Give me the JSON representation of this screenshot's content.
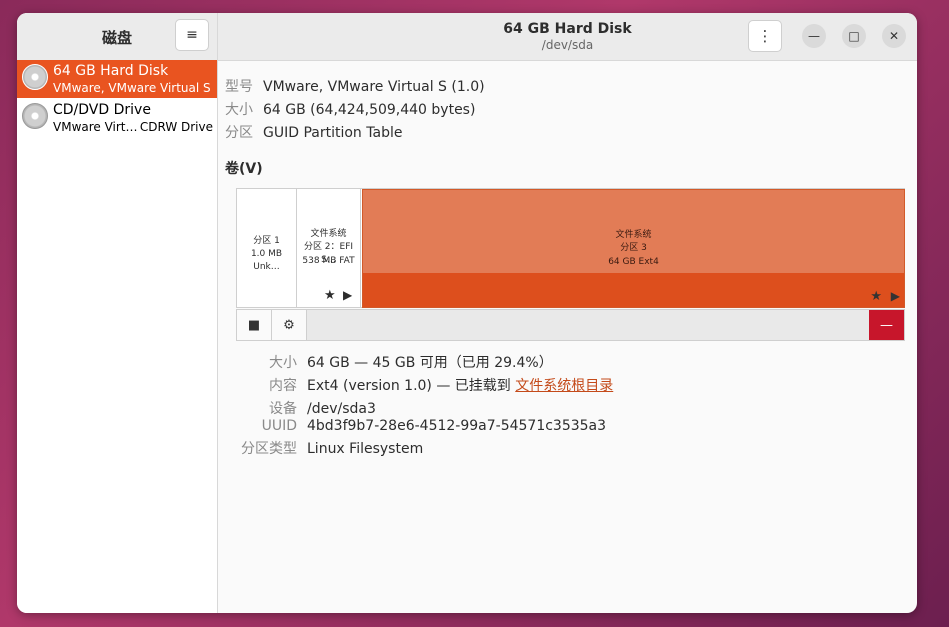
{
  "sidebar": {
    "title": "磁盘",
    "menu_icon": "≡",
    "drives": [
      {
        "name": "64 GB Hard Disk",
        "sub": "VMware, VMware Virtual S",
        "sub2": ""
      },
      {
        "name": "CD/DVD Drive",
        "sub": "VMware Virt…",
        "sub2": "CDRW Drive"
      }
    ]
  },
  "header": {
    "title": "64 GB Hard Disk",
    "subtitle": "/dev/sda",
    "more_icon": "⋮",
    "min_icon": "—",
    "max_icon": "□",
    "close_icon": "✕"
  },
  "info": {
    "model_label": "型号",
    "model_value": "VMware, VMware Virtual S (1.0)",
    "size_label": "大小",
    "size_value": "64 GB (64,424,509,440 bytes)",
    "partitioning_label": "分区",
    "partitioning_value": "GUID Partition Table"
  },
  "volumes": {
    "title": "卷(V)",
    "partitions": [
      {
        "l1": "",
        "l2": "分区 1",
        "l3": "1.0 MB Unk…"
      },
      {
        "l1": "文件系统",
        "l2": "分区 2：EFI S…",
        "l3": "538 MB FAT"
      },
      {
        "l1": "文件系统",
        "l2": "分区 3",
        "l3": "64 GB Ext4"
      }
    ],
    "star_icon": "★",
    "play_icon": "▶",
    "stop_icon": "■",
    "gear_icon": "⚙",
    "delete_icon": "—"
  },
  "details": {
    "size_label": "大小",
    "size_value": "64 GB — 45 GB 可用（已用 29.4%）",
    "contents_label": "内容",
    "contents_value": "Ext4 (version 1.0) — 已挂载到 ",
    "contents_link": "文件系统根目录",
    "device_label": "设备",
    "device_value": "/dev/sda3",
    "uuid_label": "UUID",
    "uuid_value": "4bd3f9b7-28e6-4512-99a7-54571c3535a3",
    "ptype_label": "分区类型",
    "ptype_value": "Linux Filesystem"
  }
}
